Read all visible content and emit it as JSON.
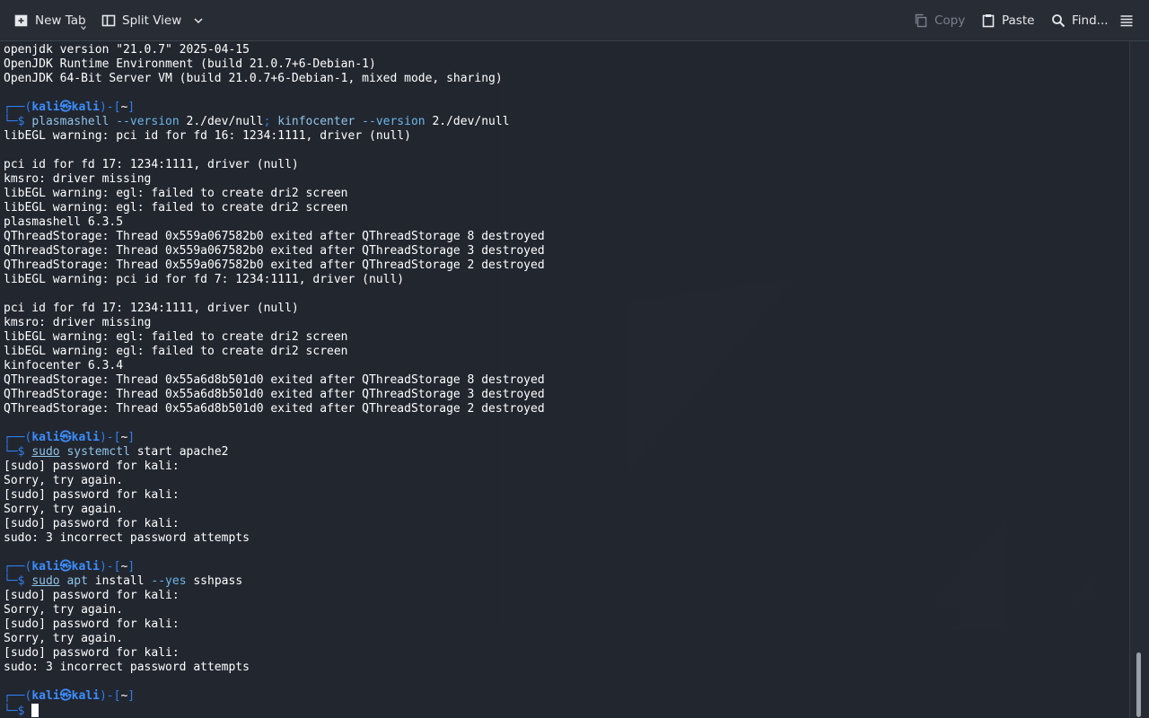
{
  "toolbar": {
    "new_tab": "New Tab",
    "split_view": "Split View",
    "copy": "Copy",
    "paste": "Paste",
    "find": "Find..."
  },
  "terminal": {
    "lines": [
      "openjdk version \"21.0.7\" 2025-04-15",
      "OpenJDK Runtime Environment (build 21.0.7+6-Debian-1)",
      "OpenJDK 64-Bit Server VM (build 21.0.7+6-Debian-1, mixed mode, sharing)",
      "libEGL warning: pci id for fd 16: 1234:1111, driver (null)",
      "pci id for fd 17: 1234:1111, driver (null)",
      "kmsro: driver missing",
      "libEGL warning: egl: failed to create dri2 screen",
      "libEGL warning: egl: failed to create dri2 screen",
      "plasmashell 6.3.5",
      "QThreadStorage: Thread 0x559a067582b0 exited after QThreadStorage 8 destroyed",
      "QThreadStorage: Thread 0x559a067582b0 exited after QThreadStorage 3 destroyed",
      "QThreadStorage: Thread 0x559a067582b0 exited after QThreadStorage 2 destroyed",
      "libEGL warning: pci id for fd 7: 1234:1111, driver (null)",
      "pci id for fd 17: 1234:1111, driver (null)",
      "kmsro: driver missing",
      "libEGL warning: egl: failed to create dri2 screen",
      "libEGL warning: egl: failed to create dri2 screen",
      "kinfocenter 6.3.4",
      "QThreadStorage: Thread 0x55a6d8b501d0 exited after QThreadStorage 8 destroyed",
      "QThreadStorage: Thread 0x55a6d8b501d0 exited after QThreadStorage 3 destroyed",
      "QThreadStorage: Thread 0x55a6d8b501d0 exited after QThreadStorage 2 destroyed",
      "[sudo] password for kali:",
      "Sorry, try again.",
      "[sudo] password for kali:",
      "Sorry, try again.",
      "[sudo] password for kali:",
      "sudo: 3 incorrect password attempts",
      "[sudo] password for kali:",
      "Sorry, try again.",
      "[sudo] password for kali:",
      "Sorry, try again.",
      "[sudo] password for kali:",
      "sudo: 3 incorrect password attempts"
    ],
    "prompt": {
      "top_left": "┌──(",
      "user": "kali",
      "at": "㉿",
      "host": "kali",
      "mid": ")-[",
      "dir": "~",
      "close": "]",
      "bottom": "└─$"
    },
    "commands": [
      {
        "p1": "plasmashell",
        "p2": " --version ",
        "p3": "2./dev/null",
        "p4": "; ",
        "p5": "kinfocenter",
        "p6": " --version ",
        "p7": "2./dev/null"
      },
      {
        "p1": "sudo",
        "p2": " ",
        "p3": "systemctl",
        "p4": " start apache2"
      },
      {
        "p1": "sudo",
        "p2": " ",
        "p3": "apt",
        "p4": " install ",
        "p5": "--yes",
        "p6": " sshpass"
      }
    ]
  }
}
